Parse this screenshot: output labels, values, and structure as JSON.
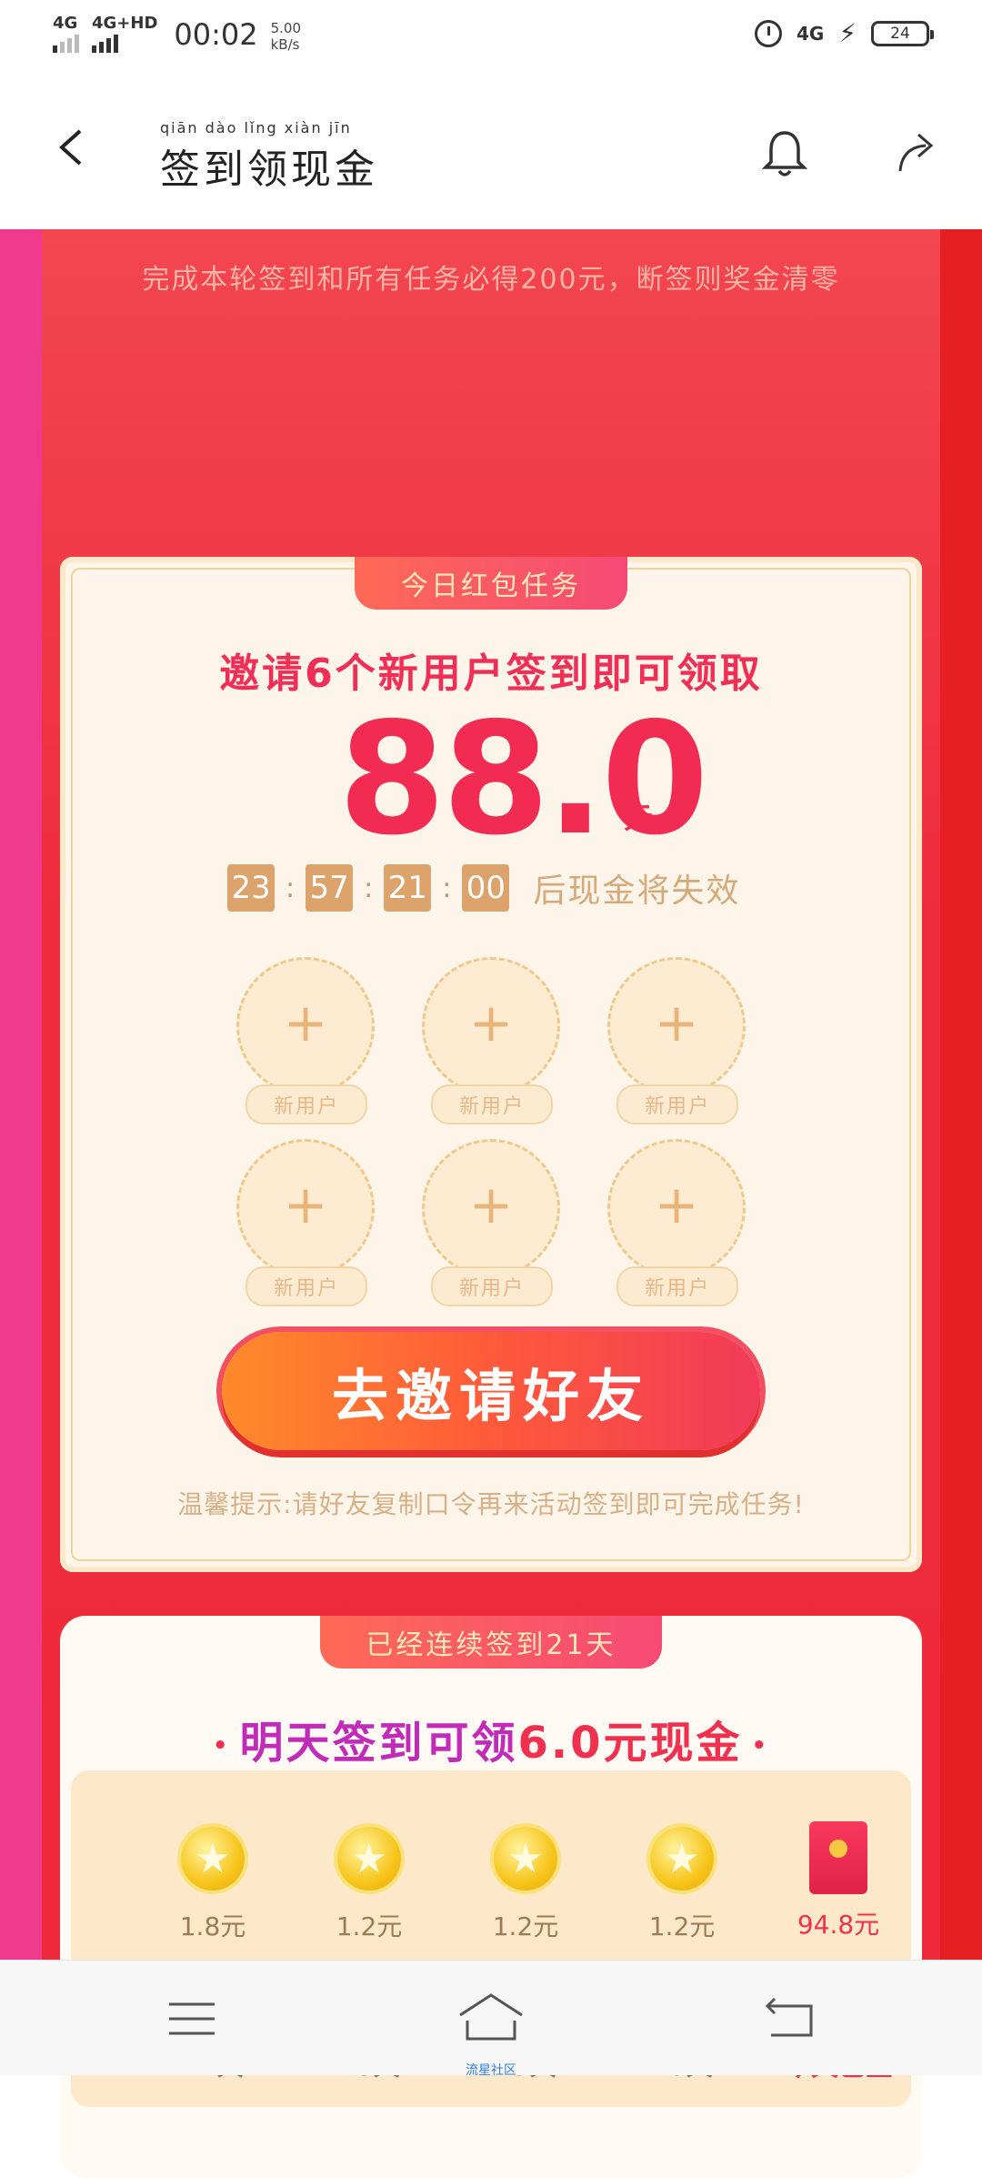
{
  "status": {
    "net1": "4G",
    "net2": "4G+HD",
    "time": "00:02",
    "speed_value": "5.00",
    "speed_unit": "kB/s",
    "right_net": "4G",
    "battery": "24"
  },
  "header": {
    "title": "签到领现金",
    "title_pinyin": "qiān  dào  lǐng  xiàn  jīn",
    "icons": [
      "back-icon",
      "bell-icon",
      "share-icon"
    ]
  },
  "notice": "完成本轮签到和所有任务必得200元，断签则奖金清零",
  "task_card": {
    "tag": "今日红包任务",
    "invite_text": "邀请6个新用户签到即可领取",
    "amount": "88.0",
    "unit": "元",
    "timer": {
      "h": "23",
      "m": "57",
      "s": "21",
      "ms": "00",
      "sep": ":"
    },
    "timer_suffix": "后现金将失效",
    "slot_label": "新用户",
    "slot_plus": "+",
    "button": "去邀请好友",
    "tip": "温馨提示:请好友复制口令再来活动签到即可完成任务!"
  },
  "checkin_card": {
    "tag": "已经连续签到21天",
    "tomorrow_pre": "明天签到可领",
    "tomorrow_amount": "6.0元现金",
    "dot": "•",
    "rewards": [
      "1.8元",
      "1.2元",
      "1.2元",
      "1.2元",
      "94.8元"
    ],
    "days": [
      "17天",
      "18天",
      "19天",
      "20天",
      "今天已签"
    ]
  },
  "nav": {
    "caption": "流星社区",
    "icons": [
      "menu-icon",
      "home-icon",
      "back-nav-icon"
    ]
  },
  "colors": {
    "main_red": "#ee2a3a",
    "accent_pink": "#ef3a8d",
    "price_red": "#f22b52",
    "gold": "#dca36d",
    "cream": "#fdf5e9"
  }
}
